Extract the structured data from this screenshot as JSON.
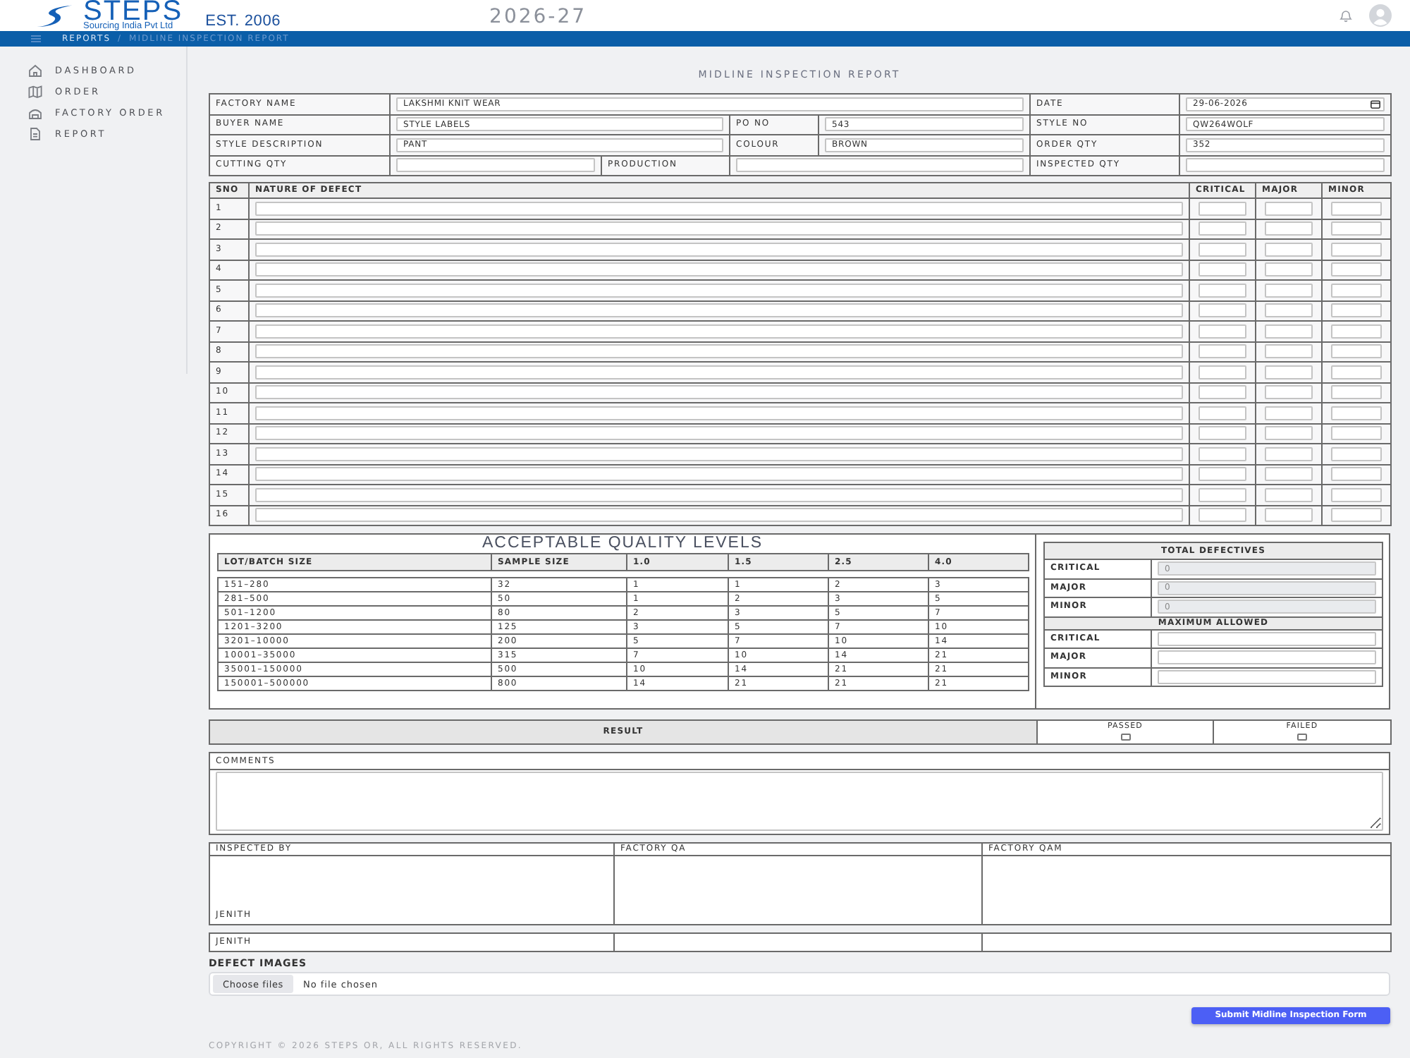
{
  "header": {
    "logo_name": "STEPS",
    "logo_tagline": "Sourcing India Pvt Ltd",
    "established": "EST. 2006",
    "year": "2026-27"
  },
  "breadcrumb": {
    "items": [
      "REPORTS",
      "MIDLINE INSPECTION REPORT"
    ],
    "separator": "/"
  },
  "sidebar": {
    "items": [
      {
        "label": "DASHBOARD",
        "selected": false
      },
      {
        "label": "ORDER",
        "selected": false
      },
      {
        "label": "FACTORY ORDER",
        "selected": false
      },
      {
        "label": "REPORT",
        "selected": false
      }
    ]
  },
  "report_title": "MIDLINE INSPECTION REPORT",
  "details": [
    [
      {
        "label": "FACTORY NAME",
        "value": "LAKSHMI KNIT WEAR",
        "kind": "text"
      },
      {
        "label": "DATE",
        "value": "29-06-2026",
        "kind": "date"
      }
    ],
    [
      {
        "label": "BUYER NAME",
        "value": "STYLE LABELS",
        "kind": "text"
      },
      {
        "label": "PO NO",
        "value": "543",
        "kind": "text"
      },
      {
        "label": "STYLE NO",
        "value": "QW264WOLF",
        "kind": "text"
      }
    ],
    [
      {
        "label": "STYLE DESCRIPTION",
        "value": "PANT",
        "kind": "text"
      },
      {
        "label": "COLOUR",
        "value": "BROWN",
        "kind": "text"
      },
      {
        "label": "ORDER QTY",
        "value": "352",
        "kind": "text"
      }
    ],
    [
      {
        "label": "CUTTING QTY",
        "kind": "text"
      },
      {
        "label": "PRODUCTION",
        "kind": "text"
      },
      {
        "label": "INSPECTED QTY",
        "kind": "text"
      }
    ]
  ],
  "defects": {
    "columns": [
      "SNO",
      "NATURE OF DEFECT",
      "CRITICAL",
      "MAJOR",
      "MINOR"
    ],
    "rows": [
      {
        "sno": "1"
      },
      {
        "sno": "2"
      },
      {
        "sno": "3"
      },
      {
        "sno": "4"
      },
      {
        "sno": "5"
      },
      {
        "sno": "6"
      },
      {
        "sno": "7"
      },
      {
        "sno": "8"
      },
      {
        "sno": "9"
      },
      {
        "sno": "10"
      },
      {
        "sno": "11"
      },
      {
        "sno": "12"
      },
      {
        "sno": "13"
      },
      {
        "sno": "14"
      },
      {
        "sno": "15"
      },
      {
        "sno": "16"
      }
    ]
  },
  "aql": {
    "title": "ACCEPTABLE QUALITY LEVELS",
    "columns": [
      "LOT/BATCH SIZE",
      "SAMPLE SIZE",
      "1.0",
      "1.5",
      "2.5",
      "4.0"
    ],
    "rows": [
      [
        "151–280",
        "32",
        "1",
        "1",
        "2",
        "3"
      ],
      [
        "281–500",
        "50",
        "1",
        "2",
        "3",
        "5"
      ],
      [
        "501–1200",
        "80",
        "2",
        "3",
        "5",
        "7"
      ],
      [
        "1201–3200",
        "125",
        "3",
        "5",
        "7",
        "10"
      ],
      [
        "3201–10000",
        "200",
        "5",
        "7",
        "10",
        "14"
      ],
      [
        "10001–35000",
        "315",
        "7",
        "10",
        "14",
        "21"
      ],
      [
        "35001–150000",
        "500",
        "10",
        "14",
        "21",
        "21"
      ],
      [
        "150001–500000",
        "800",
        "14",
        "21",
        "21",
        "21"
      ]
    ]
  },
  "total_defectives": {
    "title": "TOTAL DEFECTIVES",
    "rows": [
      {
        "label": "CRITICAL",
        "value": "0",
        "disabled": true
      },
      {
        "label": "MAJOR",
        "value": "0",
        "disabled": true
      },
      {
        "label": "MINOR",
        "value": "0",
        "disabled": true
      }
    ]
  },
  "maximum_allowed": {
    "title": "MAXIMUM ALLOWED",
    "rows": [
      {
        "label": "CRITICAL",
        "disabled": false
      },
      {
        "label": "MAJOR",
        "disabled": false
      },
      {
        "label": "MINOR",
        "disabled": false
      }
    ]
  },
  "result": {
    "label": "RESULT",
    "options": [
      {
        "label": "PASSED",
        "checked": false
      },
      {
        "label": "FAILED",
        "checked": false
      }
    ]
  },
  "comments": {
    "label": "COMMENTS"
  },
  "signatures": {
    "columns": [
      {
        "title": "INSPECTED BY",
        "signature": "JENITH"
      },
      {
        "title": "FACTORY QA"
      },
      {
        "title": "FACTORY QAM"
      }
    ],
    "names": [
      "JENITH"
    ]
  },
  "defect_images": {
    "label": "DEFECT IMAGES",
    "button": "Choose files",
    "status": "No file chosen"
  },
  "submit_button": "Submit Midline Inspection Form",
  "footer": "COPYRIGHT © 2026 STEPS OR, ALL RIGHTS RESERVED."
}
